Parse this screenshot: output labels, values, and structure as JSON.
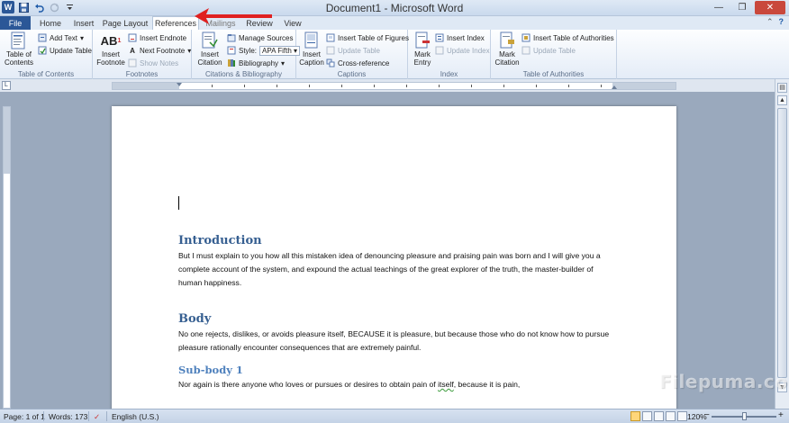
{
  "window": {
    "title": "Document1 - Microsoft Word",
    "qat_icons": [
      "word-icon",
      "save-icon",
      "undo-icon",
      "redo-icon",
      "customize-icon"
    ]
  },
  "tabs": [
    {
      "label": "File",
      "id": "file"
    },
    {
      "label": "Home",
      "id": "home"
    },
    {
      "label": "Insert",
      "id": "insert"
    },
    {
      "label": "Page Layout",
      "id": "page-layout"
    },
    {
      "label": "References",
      "id": "references",
      "active": true
    },
    {
      "label": "Mailings",
      "id": "mailings"
    },
    {
      "label": "Review",
      "id": "review"
    },
    {
      "label": "View",
      "id": "view"
    }
  ],
  "ribbon": {
    "toc": {
      "group_label": "Table of Contents",
      "table_of_contents": "Table of Contents",
      "add_text": "Add Text",
      "update_table": "Update Table"
    },
    "footnotes": {
      "group_label": "Footnotes",
      "insert_footnote": "Insert Footnote",
      "insert_endnote": "Insert Endnote",
      "next_footnote": "Next Footnote",
      "show_notes": "Show Notes"
    },
    "citations": {
      "group_label": "Citations & Bibliography",
      "insert_citation": "Insert Citation",
      "manage_sources": "Manage Sources",
      "style_label": "Style:",
      "style_value": "APA Fifth",
      "bibliography": "Bibliography"
    },
    "captions": {
      "group_label": "Captions",
      "insert_caption": "Insert Caption",
      "insert_table_of_figures": "Insert Table of Figures",
      "update_table": "Update Table",
      "cross_reference": "Cross-reference"
    },
    "index": {
      "group_label": "Index",
      "mark_entry": "Mark Entry",
      "insert_index": "Insert Index",
      "update_index": "Update Index"
    },
    "authorities": {
      "group_label": "Table of Authorities",
      "mark_citation": "Mark Citation",
      "insert_table_of_authorities": "Insert Table of Authorities",
      "update_table": "Update Table"
    }
  },
  "document": {
    "sections": [
      {
        "heading": "Introduction",
        "level": 1,
        "text": "But I must explain to you how all this mistaken idea of denouncing pleasure and praising pain was born and I will give you a complete account of the system, and expound the actual teachings of the great explorer of the truth, the master-builder of human happiness."
      },
      {
        "heading": "Body",
        "level": 1,
        "text": "No one rejects, dislikes, or avoids pleasure itself, BECAUSE it is pleasure, but because those who do not know how to pursue pleasure rationally encounter consequences that are extremely painful."
      },
      {
        "heading": "Sub-body 1",
        "level": 2,
        "text_before": "Nor again is there anyone who loves or pursues or desires to obtain pain of ",
        "text_flagged": "itself",
        "text_after": ", because it is pain,"
      }
    ]
  },
  "status": {
    "page": "Page: 1 of 1",
    "words": "Words: 173",
    "language": "English (U.S.)",
    "zoom": "120%"
  },
  "watermark": "Filepuma.com",
  "colors": {
    "heading1": "#365f91",
    "heading2": "#4f81bd",
    "file_tab": "#2b5797",
    "close_button": "#c9483c",
    "annotation_arrow": "#e02020"
  }
}
